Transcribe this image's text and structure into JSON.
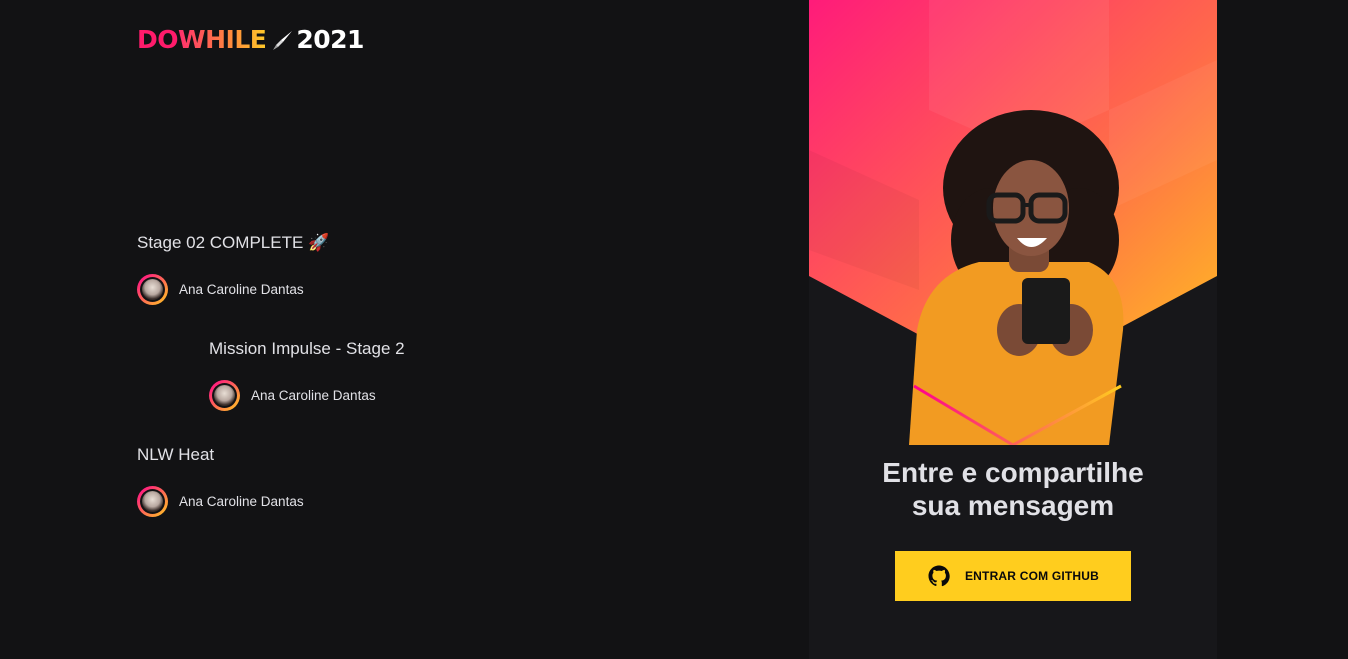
{
  "header": {
    "logo": {
      "do": "DO",
      "while": "WHILE",
      "year": "2021",
      "icon": "rocket-icon"
    }
  },
  "messages": [
    {
      "text": "Stage 02 COMPLETE 🚀",
      "user": "Ana Caroline Dantas"
    },
    {
      "text": "Mission Impulse - Stage 2",
      "user": "Ana Caroline Dantas"
    },
    {
      "text": "NLW Heat",
      "user": "Ana Caroline Dantas"
    }
  ],
  "login": {
    "title_line1": "Entre e compartilhe",
    "title_line2": "sua mensagem",
    "button_label": "ENTRAR COM GITHUB",
    "button_icon": "github-icon"
  },
  "colors": {
    "background": "#121214",
    "panel": "#17171a",
    "accent_pink": "#ff008e",
    "accent_yellow": "#ffcd1e"
  }
}
